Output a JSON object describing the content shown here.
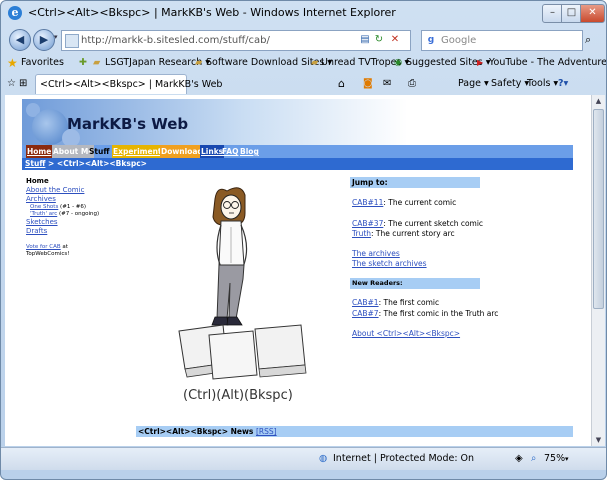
{
  "window": {
    "title": "<Ctrl><Alt><Bkspc> | MarkKB's Web - Windows Internet Explorer"
  },
  "address_bar": {
    "url": "http://markk-b.sitesled.com/stuff/cab/"
  },
  "search": {
    "placeholder": "Google"
  },
  "favorites_bar": {
    "favorites_label": "Favorites",
    "items": [
      {
        "label": "LSGTJapan Research ▾"
      },
      {
        "label": "Software Download Sites ▾"
      },
      {
        "label": "Unread TVTropes ▾"
      },
      {
        "label": "Suggested Sites ▾"
      },
      {
        "label": "YouTube - The Adventure..."
      }
    ]
  },
  "tab": {
    "label": "<Ctrl><Alt><Bkspc> | MarkKB's Web"
  },
  "command_bar": {
    "page": "Page ▾",
    "safety": "Safety ▾",
    "tools": "Tools ▾",
    "help": "?▾"
  },
  "status_bar": {
    "zone": "Internet | Protected Mode: On",
    "zoom": "75%"
  },
  "page": {
    "site_title": "MarkKB's Web",
    "nav": [
      "Home",
      "About Me",
      "Stuff",
      "Experimental",
      "Downloads",
      "Links",
      "FAQ",
      "Blog"
    ],
    "breadcrumb": {
      "link": "Stuff",
      "sep": " > ",
      "current": "<Ctrl><Alt><Bkspc>"
    },
    "sidebar": {
      "home": "Home",
      "about": "About the Comic",
      "archives": "Archives",
      "one_shots": "One Shots",
      "one_shots_note": " (#1 - #6)",
      "truth_arc": "'Truth' arc",
      "truth_note": " (#7 - ongoing)",
      "sketches": "Sketches",
      "drafts": "Drafts",
      "vote": "Vote for CAB",
      "vote_at": " at",
      "vote_site": "TopWebComics!"
    },
    "comic_title": "(Ctrl)(Alt)(Bkspc)",
    "jump_to": {
      "heading": "Jump to:",
      "items": [
        {
          "link": "CAB#11",
          "text": ": The current comic"
        },
        {
          "link": "CAB#37",
          "text": ": The current sketch comic"
        },
        {
          "link": "Truth",
          "text": ": The current story arc"
        },
        {
          "link": "The archives",
          "text": ""
        },
        {
          "link": "The sketch archives",
          "text": ""
        }
      ]
    },
    "new_readers": {
      "heading": "New Readers:",
      "items": [
        {
          "link": "CAB#1",
          "text": ": The first comic"
        },
        {
          "link": "CAB#7",
          "text": ": The first comic in the Truth arc"
        },
        {
          "link": "About <Ctrl><Alt><Bkspc>",
          "text": ""
        }
      ]
    },
    "news": {
      "title": "<Ctrl><Alt><Bkspc> News",
      "rss": "[RSS]"
    }
  }
}
